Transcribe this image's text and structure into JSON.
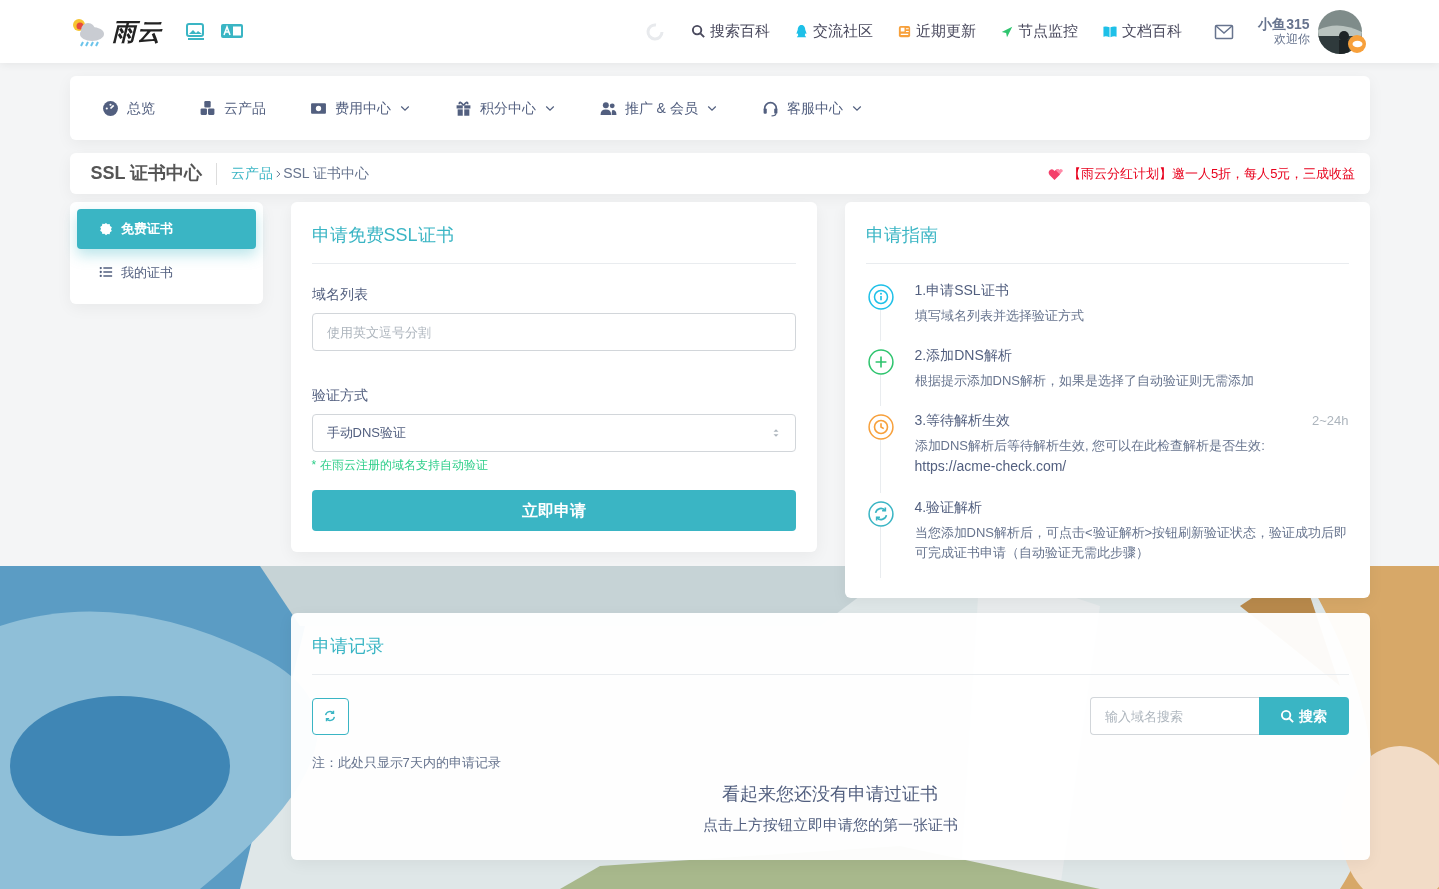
{
  "header": {
    "logo": "雨云",
    "nav": [
      {
        "kind": "search",
        "label": "搜索百科",
        "color": "#4a4a5e"
      },
      {
        "kind": "qq",
        "label": "交流社区",
        "color": "#1ec0e8"
      },
      {
        "kind": "news",
        "label": "近期更新",
        "color": "#f7a03b"
      },
      {
        "kind": "send",
        "label": "节点监控",
        "color": "#2ec46e"
      },
      {
        "kind": "book",
        "label": "文档百科",
        "color": "#1ec0e8"
      }
    ],
    "user": {
      "name": "小鱼315",
      "greeting": "欢迎你"
    }
  },
  "menu": [
    {
      "kind": "dashboard",
      "label": "总览",
      "dropdown": false
    },
    {
      "kind": "cubes",
      "label": "云产品",
      "dropdown": false
    },
    {
      "kind": "money",
      "label": "费用中心",
      "dropdown": true
    },
    {
      "kind": "gift",
      "label": "积分中心",
      "dropdown": true
    },
    {
      "kind": "users",
      "label": "推广 & 会员",
      "dropdown": true
    },
    {
      "kind": "headset",
      "label": "客服中心",
      "dropdown": true
    }
  ],
  "page_title": "SSL 证书中心",
  "breadcrumb": [
    {
      "label": "云产品",
      "link": true
    },
    {
      "label": "SSL 证书中心",
      "link": false
    }
  ],
  "promo": "【雨云分红计划】邀一人5折，每人5元，三成收益",
  "sidebar": [
    {
      "kind": "badge",
      "label": "免费证书",
      "selected": true
    },
    {
      "kind": "list",
      "label": "我的证书",
      "selected": false
    }
  ],
  "apply_form": {
    "title": "申请免费SSL证书",
    "domain_label": "域名列表",
    "domain_placeholder": "使用英文逗号分割",
    "method_label": "验证方式",
    "method_value": "手动DNS验证",
    "hint": "* 在雨云注册的域名支持自动验证",
    "submit": "立即申请"
  },
  "guide": {
    "title": "申请指南",
    "steps": [
      {
        "kind": "info",
        "color": "#1ec0e8",
        "title": "1.申请SSL证书",
        "desc": "填写域名列表并选择验证方式"
      },
      {
        "kind": "plus",
        "color": "#2ec46e",
        "title": "2.添加DNS解析",
        "desc": "根据提示添加DNS解析，如果是选择了自动验证则无需添加"
      },
      {
        "kind": "clock",
        "color": "#f7a03b",
        "title": "3.等待解析生效",
        "time": "2~24h",
        "desc": "添加DNS解析后等待解析生效, 您可以在此检查解析是否生效:",
        "link": "https://acme-check.com/"
      },
      {
        "kind": "sync",
        "color": "#3ab5c4",
        "title": "4.验证解析",
        "desc": "当您添加DNS解析后，可点击<验证解析>按钮刷新验证状态，验证成功后即可完成证书申请（自动验证无需此步骤）"
      }
    ]
  },
  "records": {
    "title": "申请记录",
    "search_placeholder": "输入域名搜索",
    "search_button": "搜索",
    "note": "注：此处只显示7天内的申请记录",
    "empty_title": "看起来您还没有申请过证书",
    "empty_subtitle": "点击上方按钮立即申请您的第一张证书"
  }
}
